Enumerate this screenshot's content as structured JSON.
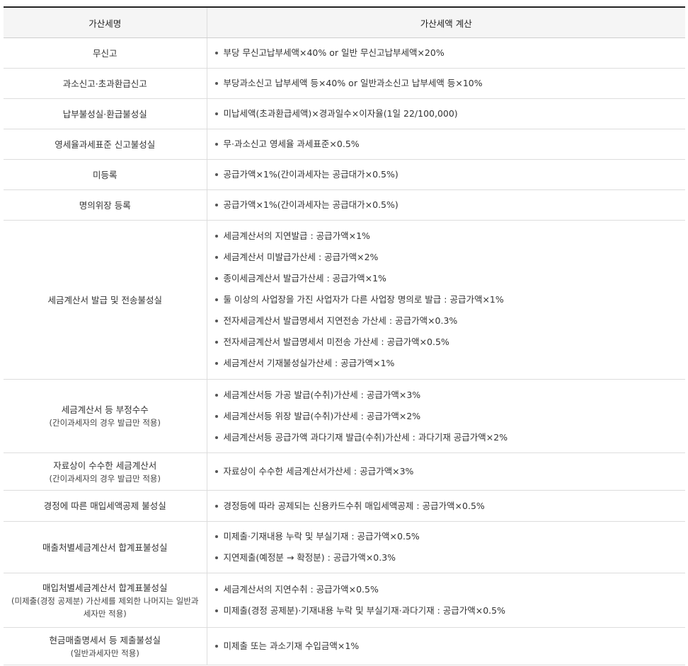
{
  "headers": {
    "name": "가산세명",
    "calc": "가산세액 계산"
  },
  "rows": [
    {
      "name": "무신고",
      "sub": "",
      "items": [
        "부당 무신고납부세액×40% or 일반 무신고납부세액×20%"
      ]
    },
    {
      "name": "과소신고·초과환급신고",
      "sub": "",
      "items": [
        "부당과소신고 납부세액 등×40% or 일반과소신고 납부세액 등×10%"
      ]
    },
    {
      "name": "납부불성실·환급불성실",
      "sub": "",
      "items": [
        "미납세액(초과환급세액)×경과일수×이자율(1일 22/100,000)"
      ]
    },
    {
      "name": "영세율과세표준 신고불성실",
      "sub": "",
      "items": [
        "무·과소신고 영세율 과세표준×0.5%"
      ]
    },
    {
      "name": "미등록",
      "sub": "",
      "items": [
        "공급가액×1%(간이과세자는 공급대가×0.5%)"
      ]
    },
    {
      "name": "명의위장 등록",
      "sub": "",
      "items": [
        "공급가액×1%(간이과세자는 공급대가×0.5%)"
      ]
    },
    {
      "name": "세금계산서 발급 및 전송불성실",
      "sub": "",
      "items": [
        "세금계산서의 지연발급 : 공급가액×1%",
        "세금계산서 미발급가산세 : 공급가액×2%",
        "종이세금계산서 발급가산세 : 공급가액×1%",
        "둘 이상의 사업장을 가진 사업자가 다른 사업장 명의로 발급 : 공급가액×1%",
        "전자세금계산서 발급명세서 지연전송 가산세 : 공급가액×0.3%",
        "전자세금계산서 발급명세서 미전송 가산세 : 공급가액×0.5%",
        "세금계산서 기재불성실가산세 : 공급가액×1%"
      ]
    },
    {
      "name": "세금계산서 등 부정수수",
      "sub": "(간이과세자의 경우 발급만 적용)",
      "items": [
        "세금계산서등 가공 발급(수취)가산세 : 공급가액×3%",
        "세금계산서등 위장 발급(수취)가산세 : 공급가액×2%",
        "세금계산서등 공급가액 과다기재 발급(수취)가산세 : 과다기재 공급가액×2%"
      ]
    },
    {
      "name": "자료상이 수수한 세금계산서",
      "sub": "(간이과세자의 경우 발급만 적용)",
      "items": [
        "자료상이 수수한 세금계산서가산세 : 공급가액×3%"
      ]
    },
    {
      "name": "경정에 따른 매입세액공제 불성실",
      "sub": "",
      "items": [
        "경정등에 따라 공제되는 신용카드수취 매입세액공제 : 공급가액×0.5%"
      ]
    },
    {
      "name": "매출처별세금계산서 합계표불성실",
      "sub": "",
      "items": [
        "미제출·기재내용 누락 및 부실기재 : 공급가액×0.5%",
        "지연제출(예정분 → 확정분) : 공급가액×0.3%"
      ]
    },
    {
      "name": "매입처별세금계산서 합계표불성실",
      "sub": "(미제출(경정 공제분) 가산세를 제외한 나머지는 일반과세자만 적용)",
      "items": [
        "세금계산서의 지연수취 : 공급가액×0.5%",
        "미제출(경정 공제분)·기재내용 누락 및 부실기재·과다기재 : 공급가액×0.5%"
      ]
    },
    {
      "name": "현금매출명세서 등 제출불성실",
      "sub": "(일반과세자만 적용)",
      "items": [
        "미제출 또는 과소기재 수입금액×1%"
      ]
    }
  ]
}
